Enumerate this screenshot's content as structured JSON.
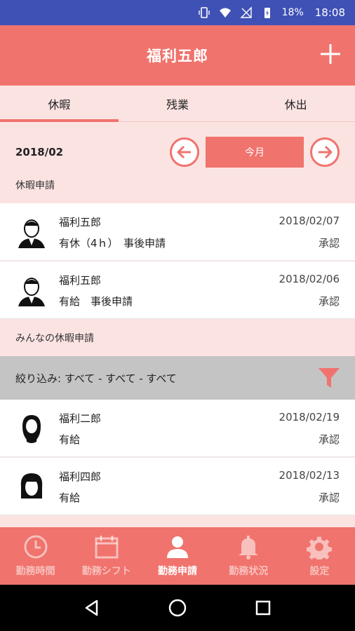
{
  "status_bar": {
    "battery": "18%",
    "time": "18:08"
  },
  "app_bar": {
    "title": "福利五郎"
  },
  "tabs": [
    {
      "label": "休暇",
      "active": true
    },
    {
      "label": "残業",
      "active": false
    },
    {
      "label": "休出",
      "active": false
    }
  ],
  "month_nav": {
    "year_month": "2018/02",
    "this_month_label": "今月"
  },
  "my_requests": {
    "header": "休暇申請",
    "items": [
      {
        "name": "福利五郎",
        "type": "有休（4ｈ）　事後申請",
        "date": "2018/02/07",
        "status": "承認"
      },
      {
        "name": "福利五郎",
        "type": "有給　事後申請",
        "date": "2018/02/06",
        "status": "承認"
      }
    ]
  },
  "everyone_requests": {
    "header": "みんなの休暇申請",
    "filter_label": "絞り込み: すべて - すべて - すべて",
    "items": [
      {
        "name": "福利二郎",
        "type": "有給",
        "date": "2018/02/19",
        "status": "承認"
      },
      {
        "name": "福利四郎",
        "type": "有給",
        "date": "2018/02/13",
        "status": "承認"
      }
    ]
  },
  "bottom_nav": [
    {
      "label": "勤務時間",
      "icon": "clock-icon",
      "active": false
    },
    {
      "label": "勤務シフト",
      "icon": "calendar-icon",
      "active": false
    },
    {
      "label": "勤務申請",
      "icon": "person-icon",
      "active": true
    },
    {
      "label": "勤務状況",
      "icon": "bell-icon",
      "active": false
    },
    {
      "label": "設定",
      "icon": "gear-icon",
      "active": false
    }
  ],
  "colors": {
    "primary": "#f0736d",
    "background": "#fbe3e2",
    "status_bar": "#3f51b5",
    "filter_bar": "#c4c4c4"
  }
}
